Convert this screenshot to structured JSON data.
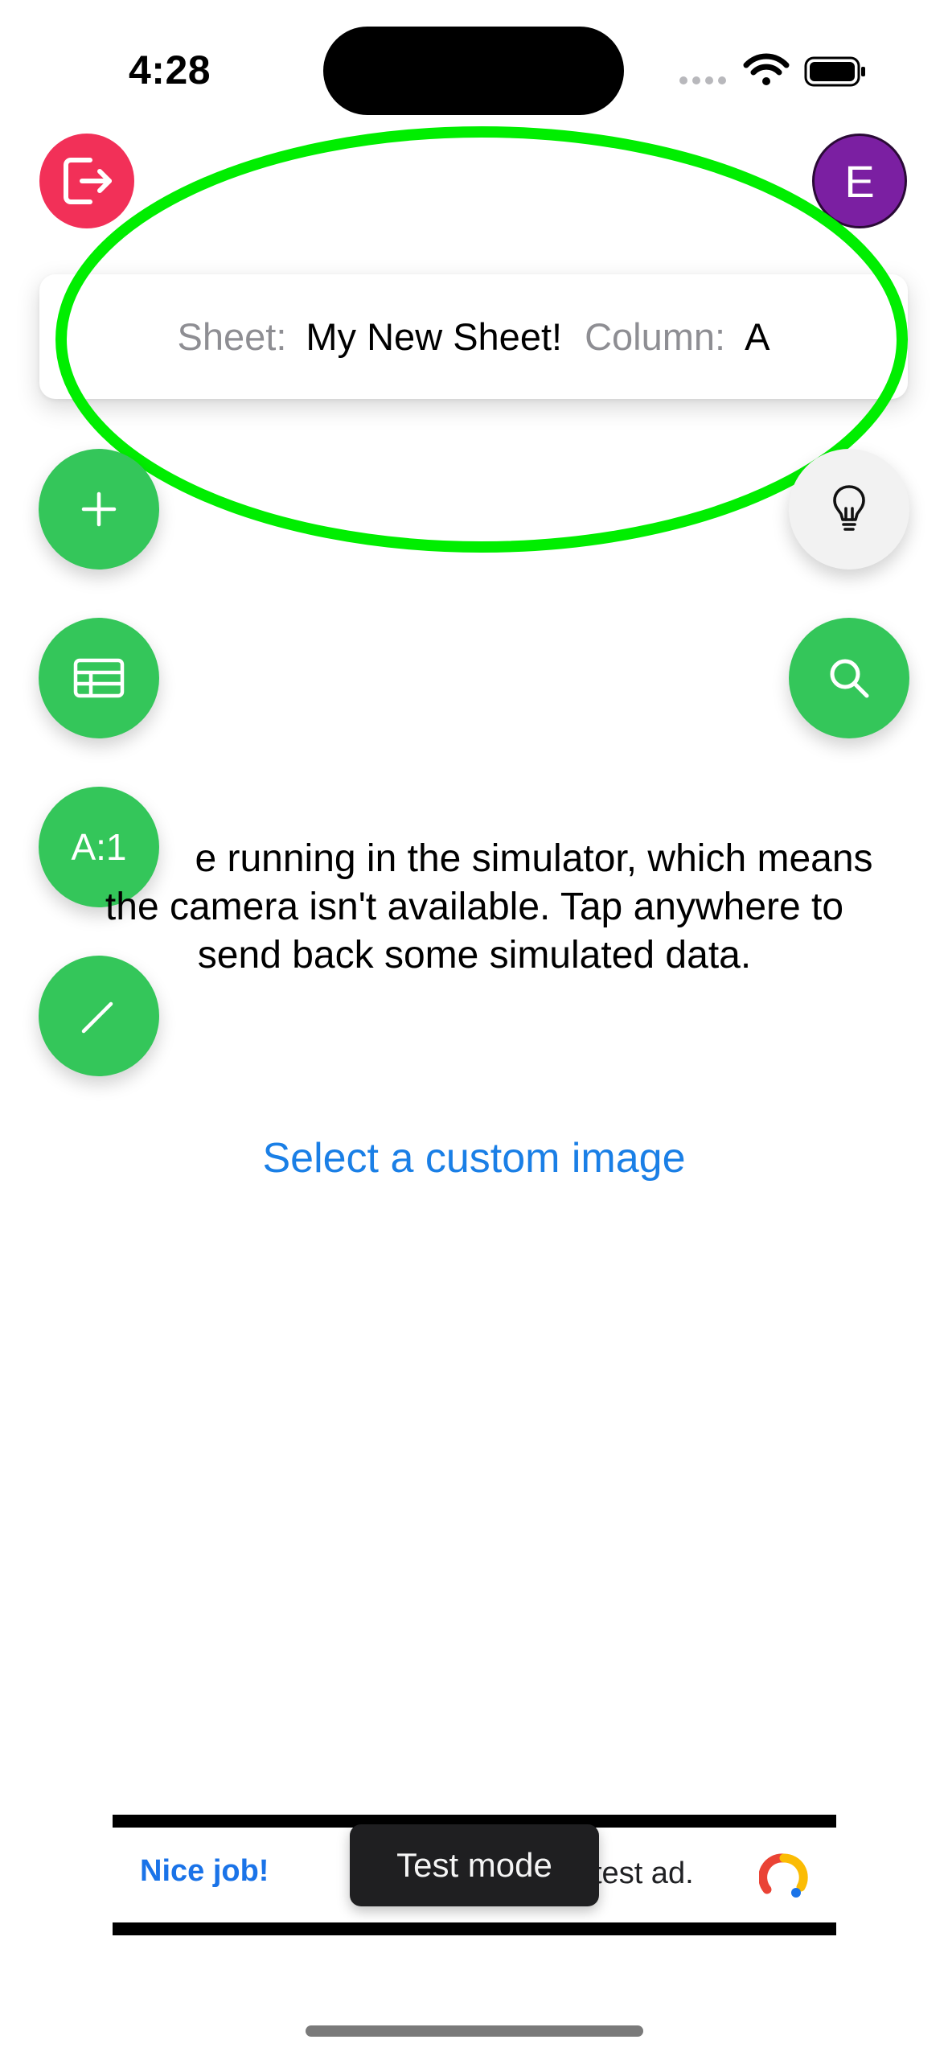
{
  "status_bar": {
    "time": "4:28",
    "icons": [
      "cellular-dots-icon",
      "wifi-icon",
      "battery-icon"
    ]
  },
  "header": {
    "signout_icon": "sign-out-icon",
    "avatar_letter": "E",
    "avatar_color": "#7b1fa2",
    "signout_color": "#f23058"
  },
  "sheet_info": {
    "sheet_label": "Sheet:",
    "sheet_value": "My New Sheet!",
    "column_label": "Column:",
    "column_value": "A"
  },
  "fabs": {
    "left": [
      {
        "name": "add",
        "icon": "plus-icon"
      },
      {
        "name": "sheets",
        "icon": "table-icon"
      },
      {
        "name": "cell",
        "label": "A:1"
      },
      {
        "name": "edit",
        "icon": "pencil-icon"
      }
    ],
    "right": [
      {
        "name": "hint",
        "icon": "lightbulb-icon"
      },
      {
        "name": "search",
        "icon": "search-icon"
      }
    ],
    "accent_color": "#34c65a"
  },
  "simulator": {
    "line1": "e running in the simulator, which means",
    "line2": "the camera isn't available. Tap anywhere to",
    "line3": "send back some simulated data.",
    "custom_image_link": "Select a custom image"
  },
  "ad": {
    "nice_job": "Nice job!",
    "text_fragment": "test ad.",
    "test_mode_label": "Test mode"
  },
  "highlight_color": "#00ee00"
}
